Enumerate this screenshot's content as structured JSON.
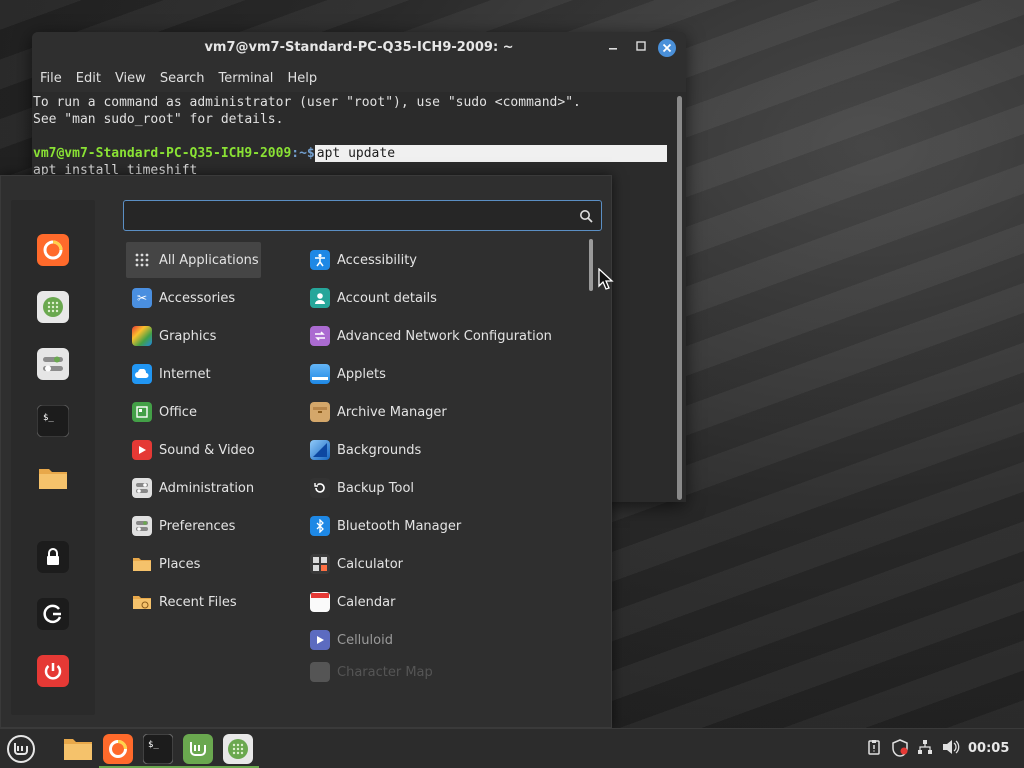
{
  "terminal": {
    "title": "vm7@vm7-Standard-PC-Q35-ICH9-2009: ~",
    "menu": [
      "File",
      "Edit",
      "View",
      "Search",
      "Terminal",
      "Help"
    ],
    "lines": [
      "To run a command as administrator (user \"root\"), use \"sudo <command>\".",
      "See \"man sudo_root\" for details."
    ],
    "prompt_user": "vm7@vm7-Standard-PC-Q35-ICH9-2009",
    "prompt_path": ":~$",
    "current_command": " apt update",
    "next_line": "apt install timeshift"
  },
  "menu": {
    "search": {
      "value": "",
      "placeholder": ""
    },
    "favorites": [
      "firefox-icon",
      "software-manager-icon",
      "settings-icon",
      "terminal-icon",
      "files-icon"
    ],
    "session": [
      "lock-icon",
      "logout-icon",
      "power-icon"
    ],
    "categories": [
      {
        "label": "All Applications",
        "icon": "grid-icon",
        "selected": true
      },
      {
        "label": "Accessories",
        "icon": "scissors-icon"
      },
      {
        "label": "Graphics",
        "icon": "graphics-icon"
      },
      {
        "label": "Internet",
        "icon": "cloud-icon"
      },
      {
        "label": "Office",
        "icon": "office-icon"
      },
      {
        "label": "Sound & Video",
        "icon": "play-icon"
      },
      {
        "label": "Administration",
        "icon": "admin-icon"
      },
      {
        "label": "Preferences",
        "icon": "preferences-icon"
      },
      {
        "label": "Places",
        "icon": "folder-icon"
      },
      {
        "label": "Recent Files",
        "icon": "recent-folder-icon"
      }
    ],
    "apps": [
      {
        "label": "Accessibility",
        "icon": "accessibility-icon"
      },
      {
        "label": "Account details",
        "icon": "account-icon"
      },
      {
        "label": "Advanced Network Configuration",
        "icon": "network-config-icon"
      },
      {
        "label": "Applets",
        "icon": "applets-icon"
      },
      {
        "label": "Archive Manager",
        "icon": "archive-icon"
      },
      {
        "label": "Backgrounds",
        "icon": "backgrounds-icon"
      },
      {
        "label": "Backup Tool",
        "icon": "backup-icon"
      },
      {
        "label": "Bluetooth Manager",
        "icon": "bluetooth-icon"
      },
      {
        "label": "Calculator",
        "icon": "calculator-icon"
      },
      {
        "label": "Calendar",
        "icon": "calendar-icon"
      },
      {
        "label": "Celluloid",
        "icon": "celluloid-icon"
      },
      {
        "label": "Character Map",
        "icon": "character-map-icon"
      }
    ]
  },
  "taskbar": {
    "launchers": [
      "mint-menu-icon",
      "files-icon",
      "firefox-icon",
      "terminal-icon",
      "mint-update-icon",
      "software-manager-icon"
    ],
    "tray": [
      "clipboard-icon",
      "shield-icon",
      "network-icon",
      "volume-icon"
    ],
    "clock": "00:05"
  },
  "colors": {
    "accent": "#5b8fc4",
    "prompt_user": "#8ae234",
    "prompt_path": "#729fcf",
    "mint_green": "#6aa84f"
  }
}
